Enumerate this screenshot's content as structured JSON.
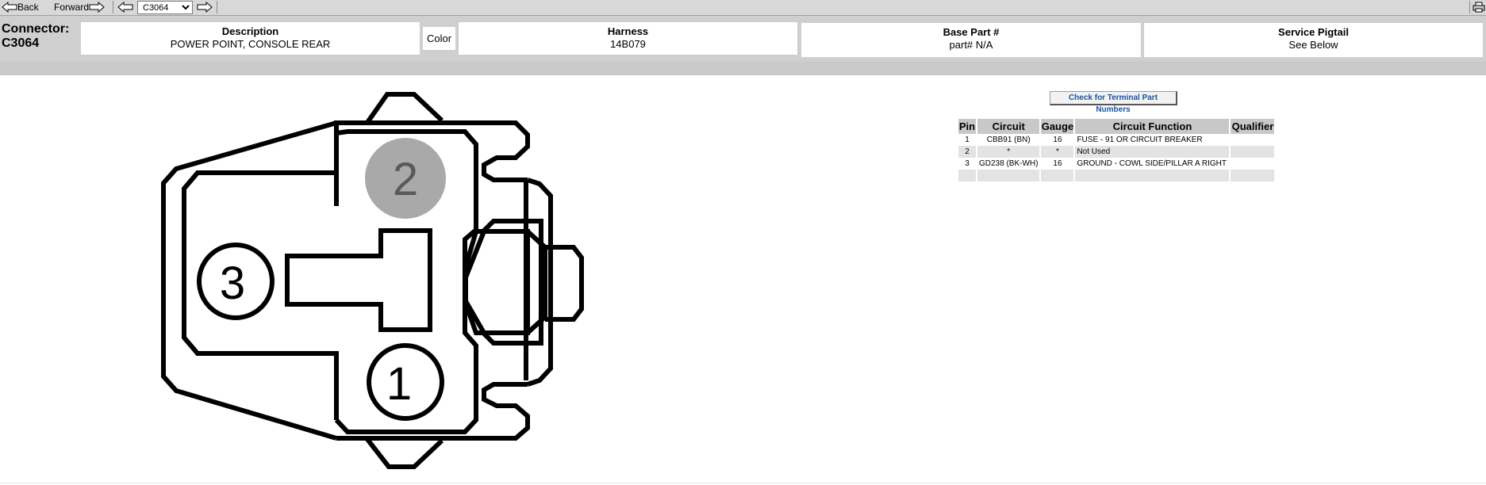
{
  "toolbar": {
    "back_label": "Back",
    "forward_label": "Forward",
    "selected_connector": "C3064",
    "connector_options": [
      "C3064"
    ]
  },
  "header": {
    "connector_label_line1": "Connector:",
    "connector_label_line2": "C3064",
    "description_header": "Description",
    "description_value": "POWER POINT, CONSOLE REAR",
    "color_label": "Color",
    "harness_header": "Harness",
    "harness_value": "14B079",
    "base_part_header": "Base Part #",
    "base_part_value": "part# N/A",
    "service_pigtail_header": "Service Pigtail",
    "service_pigtail_value": "See Below"
  },
  "diagram": {
    "pin_labels": [
      "1",
      "2",
      "3"
    ],
    "highlighted_pin": "2",
    "highlight_color": "#a9a9a9"
  },
  "terminal_button_label": "Check for Terminal Part Numbers",
  "pin_table": {
    "columns": [
      "Pin",
      "Circuit",
      "Gauge",
      "Circuit Function",
      "Qualifier"
    ],
    "rows": [
      {
        "pin": "1",
        "circuit": "CBB91 (BN)",
        "gauge": "16",
        "function": "FUSE - 91 OR CIRCUIT BREAKER",
        "qualifier": ""
      },
      {
        "pin": "2",
        "circuit": "*",
        "gauge": "*",
        "function": "Not Used",
        "qualifier": ""
      },
      {
        "pin": "3",
        "circuit": "GD238 (BK-WH)",
        "gauge": "16",
        "function": "GROUND - COWL SIDE/PILLAR A RIGHT",
        "qualifier": ""
      },
      {
        "pin": "",
        "circuit": "",
        "gauge": "",
        "function": "",
        "qualifier": ""
      }
    ]
  }
}
